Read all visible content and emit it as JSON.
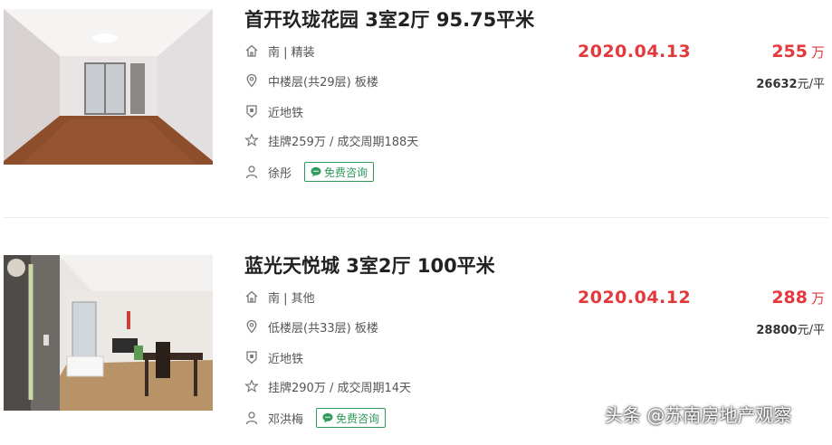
{
  "listings": [
    {
      "title": "首开玖珑花园 3室2厅 95.75平米",
      "orientation_decoration": "南 | 精装",
      "floor_info": "中楼层(共29层) 板楼",
      "subway": "近地铁",
      "listing_cycle": "挂牌259万 / 成交周期188天",
      "agent": "徐彤",
      "chat_label": "免费咨询",
      "deal_date": "2020.04.13",
      "total_price": "255",
      "price_unit": "万",
      "unit_price": "26632",
      "unit_price_suffix": "元/平"
    },
    {
      "title": "蓝光天悦城 3室2厅 100平米",
      "orientation_decoration": "南 | 其他",
      "floor_info": "低楼层(共33层) 板楼",
      "subway": "近地铁",
      "listing_cycle": "挂牌290万 / 成交周期14天",
      "agent": "邓洪梅",
      "chat_label": "免费咨询",
      "deal_date": "2020.04.12",
      "total_price": "288",
      "price_unit": "万",
      "unit_price": "28800",
      "unit_price_suffix": "元/平"
    }
  ],
  "watermark": "头条 @苏南房地产观察",
  "icons": {
    "house": "house-icon",
    "location": "location-pin-icon",
    "subway": "subway-shield-icon",
    "star": "star-icon",
    "person": "person-icon",
    "chat": "chat-bubble-icon"
  },
  "colors": {
    "price_red": "#e4393c",
    "chat_green": "#2e9b5a"
  }
}
